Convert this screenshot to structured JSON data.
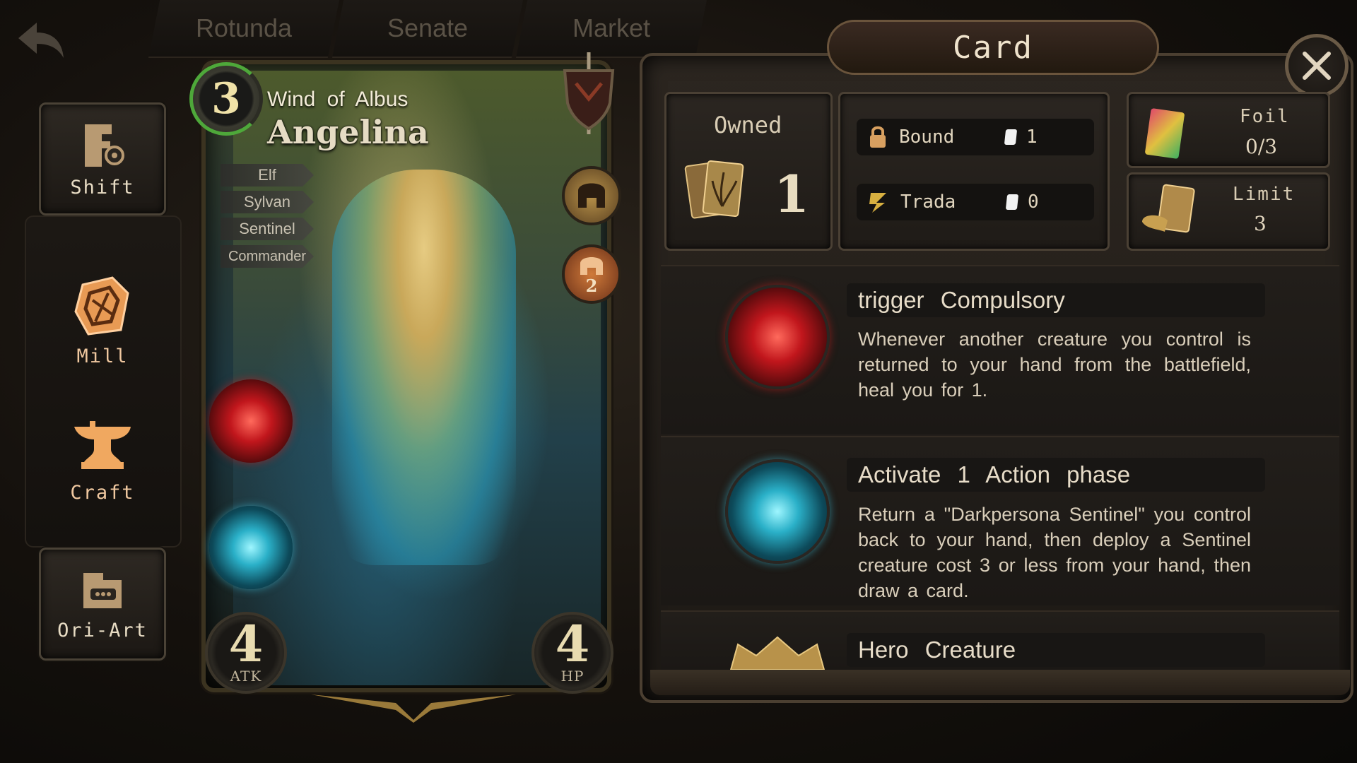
{
  "nav": {
    "tabs": [
      {
        "label": "Rotunda"
      },
      {
        "label": "Senate"
      },
      {
        "label": "Market"
      }
    ]
  },
  "sidebar": {
    "items": [
      {
        "label": "Shift",
        "icon": "shift-scroll-icon"
      },
      {
        "label": "Mill",
        "icon": "mill-card-icon"
      },
      {
        "label": "Craft",
        "icon": "anvil-icon"
      },
      {
        "label": "Ori-Art",
        "icon": "ori-art-icon"
      }
    ]
  },
  "card": {
    "cost": "3",
    "subtitle": "Wind of Albus",
    "name": "Angelina",
    "tribes": [
      "Elf",
      "Sylvan",
      "Sentinel",
      "Commander"
    ],
    "atk": "4",
    "atk_label": "ATK",
    "hp": "4",
    "hp_label": "HP",
    "emblem_count": "2"
  },
  "panel": {
    "title": "Card",
    "owned_label": "Owned",
    "owned_count": "1",
    "bound_label": "Bound",
    "bound_count": "1",
    "trade_label": "Trada",
    "trade_count": "0",
    "foil_label": "Foil",
    "foil_value": "0/3",
    "limit_label": "Limit",
    "limit_value": "3",
    "abilities": [
      {
        "head": "trigger  Compulsory",
        "text": "Whenever another creature you control is returned to your hand from the battlefield, heal you for 1.",
        "icon": "fire-orb-icon"
      },
      {
        "head": "Activate 1  Action phase",
        "text": "Return a \"Darkpersona Sentinel\" you control back to your hand, then deploy a Sentinel creature cost 3 or less from your hand, then draw a card.",
        "icon": "moon-orb-icon"
      },
      {
        "head": "Hero Creature",
        "text": "",
        "icon": "crown-icon"
      }
    ]
  },
  "colors": {
    "accent_gold": "#e8dbb0",
    "fire_red": "#c1161c",
    "frost_blue": "#2ab0c8",
    "cost_ring_green": "#4ea83a"
  }
}
